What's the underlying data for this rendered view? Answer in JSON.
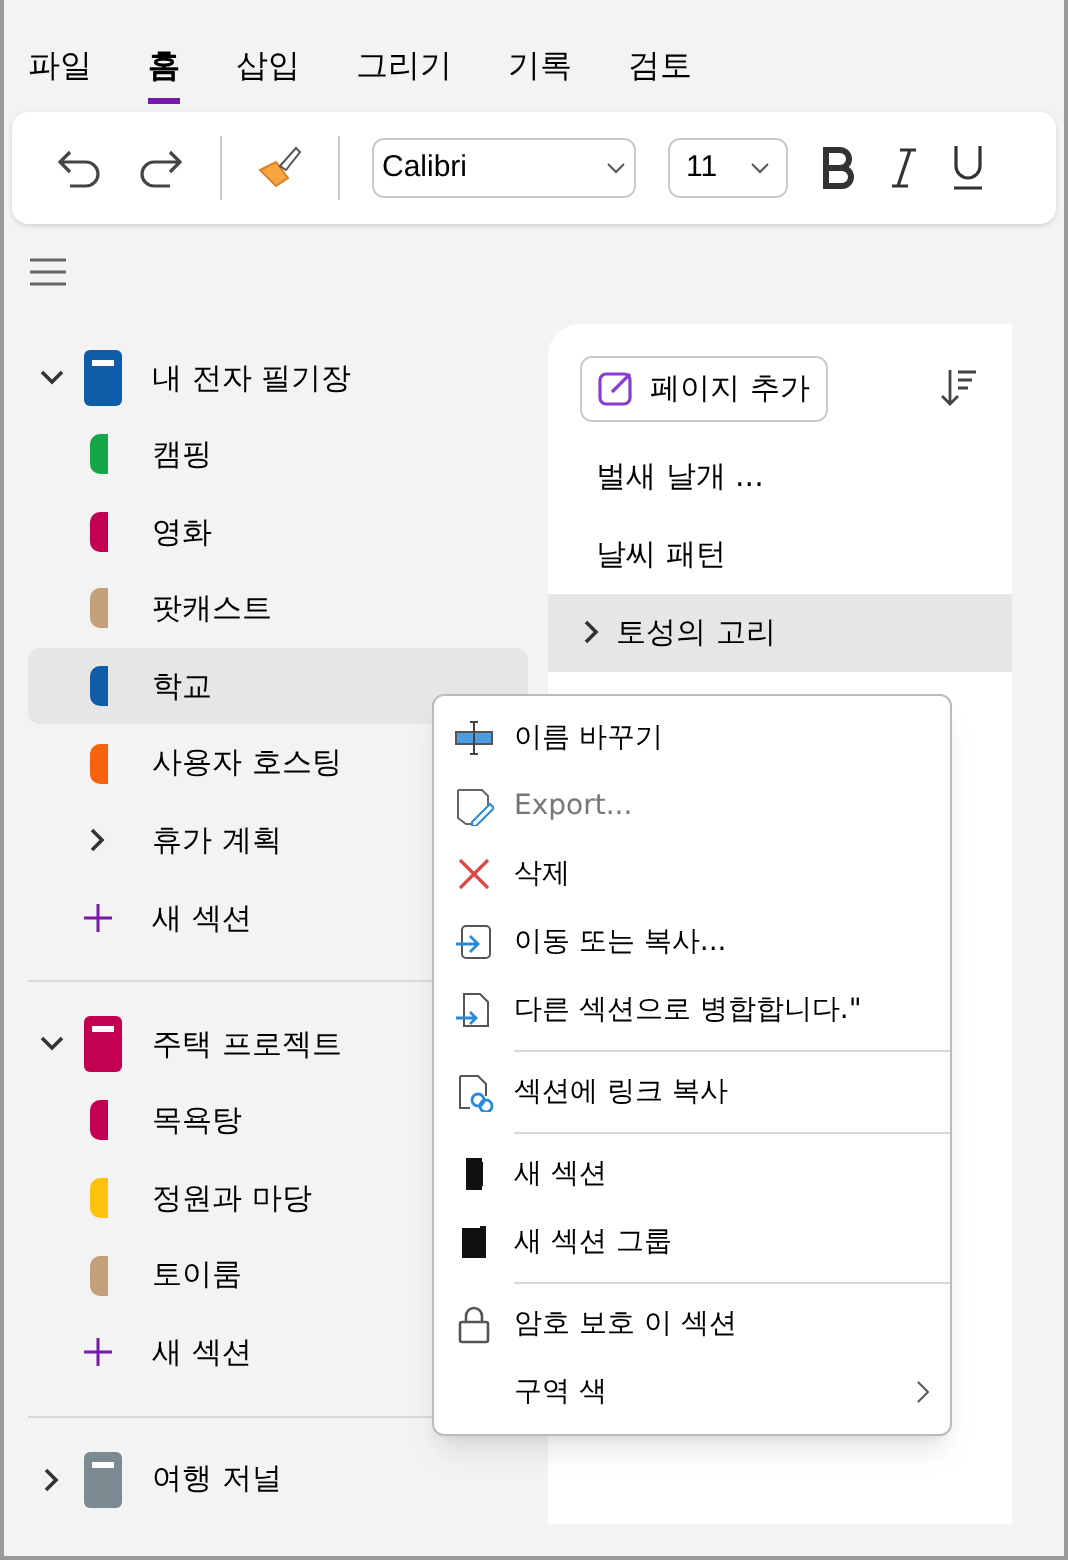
{
  "tabs": [
    {
      "label": "파일",
      "selected": false
    },
    {
      "label": "홈",
      "selected": true
    },
    {
      "label": "삽입",
      "selected": false
    },
    {
      "label": "그리기",
      "selected": false
    },
    {
      "label": "기록",
      "selected": false
    },
    {
      "label": "검토",
      "selected": false
    }
  ],
  "ribbon": {
    "font": "Calibri",
    "size": "11"
  },
  "notebooks": [
    {
      "name": "내 전자 필기장",
      "color": "#0f5ca8",
      "expanded": true,
      "sections": [
        {
          "kind": "section",
          "name": "캠핑",
          "color": "#13a74a",
          "selected": false
        },
        {
          "kind": "section",
          "name": "영화",
          "color": "#c30052",
          "selected": false
        },
        {
          "kind": "section",
          "name": "팟캐스트",
          "color": "#c4a17a",
          "selected": false
        },
        {
          "kind": "section",
          "name": "학교",
          "color": "#0f5ca8",
          "selected": true
        },
        {
          "kind": "section",
          "name": "사용자 호스팅",
          "color": "#f7630c",
          "selected": false
        },
        {
          "kind": "group",
          "name": "휴가 계획",
          "selected": false
        },
        {
          "kind": "add",
          "name": "새 섹션",
          "selected": false
        }
      ]
    },
    {
      "name": "주택 프로젝트",
      "color": "#c30052",
      "expanded": true,
      "sections": [
        {
          "kind": "section",
          "name": "목욕탕",
          "color": "#c30052",
          "selected": false
        },
        {
          "kind": "section",
          "name": "정원과 마당",
          "color": "#ffc20e",
          "selected": false
        },
        {
          "kind": "section",
          "name": "토이룸",
          "color": "#c4a17a",
          "selected": false
        },
        {
          "kind": "add",
          "name": "새 섹션",
          "selected": false
        }
      ]
    },
    {
      "name": "여행 저널",
      "color": "#7a8a90",
      "expanded": false
    }
  ],
  "pages": {
    "add_label": "페이지 추가",
    "items": [
      {
        "title": "벌새 날개 ...",
        "selected": false,
        "has_children": false
      },
      {
        "title": "날씨 패턴",
        "selected": false,
        "has_children": false
      },
      {
        "title": "토성의 고리",
        "selected": true,
        "has_children": true
      }
    ]
  },
  "context_menu": [
    {
      "kind": "rename",
      "label": "이름 바꾸기",
      "disabled": false,
      "divider_after": false
    },
    {
      "kind": "export",
      "label": "Export...",
      "disabled": true,
      "divider_after": false
    },
    {
      "kind": "delete",
      "label": "삭제",
      "disabled": false,
      "divider_after": false
    },
    {
      "kind": "move",
      "label": "이동 또는 복사...",
      "disabled": false,
      "divider_after": false
    },
    {
      "kind": "merge",
      "label": "다른 섹션으로 병합합니다.\"",
      "disabled": false,
      "divider_after": true
    },
    {
      "kind": "link",
      "label": "섹션에 링크 복사",
      "disabled": false,
      "divider_after": true
    },
    {
      "kind": "section",
      "label": "새 섹션",
      "disabled": false,
      "divider_after": false
    },
    {
      "kind": "group",
      "label": "새 섹션 그룹",
      "disabled": false,
      "divider_after": true
    },
    {
      "kind": "lock",
      "label": "암호 보호 이 섹션",
      "disabled": false,
      "divider_after": false
    },
    {
      "kind": "color",
      "label": "구역 색",
      "disabled": false,
      "divider_after": false,
      "submenu": true
    }
  ]
}
